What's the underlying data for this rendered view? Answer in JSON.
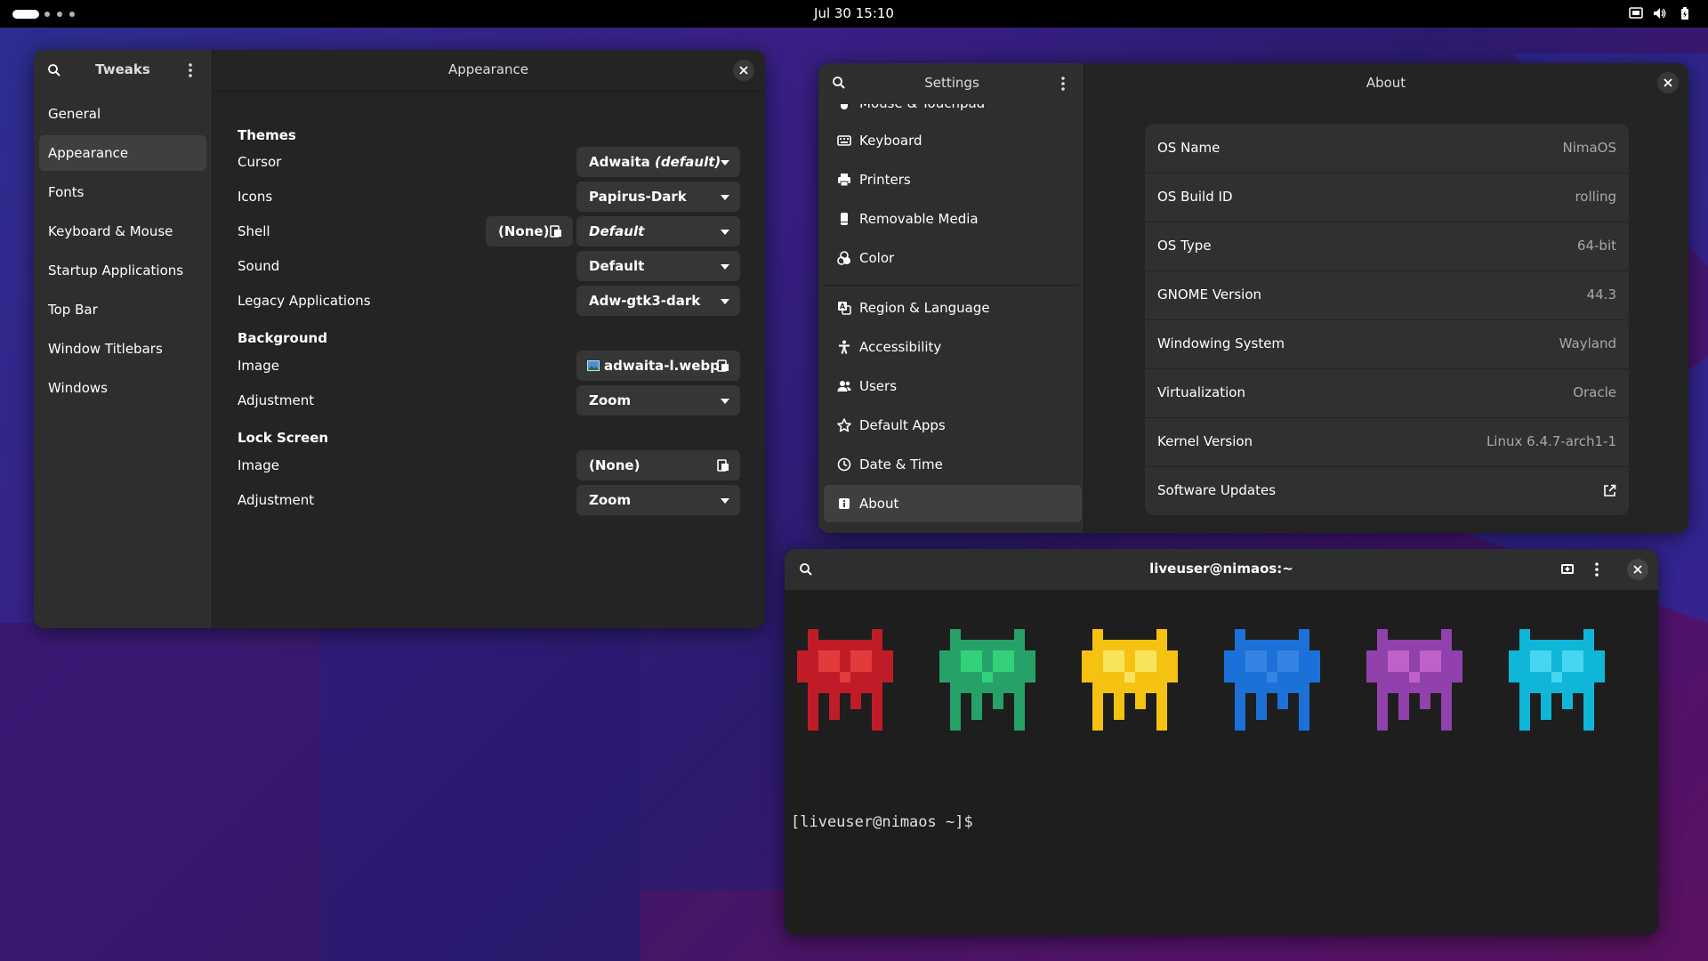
{
  "topbar": {
    "datetime": "Jul 30  15:10"
  },
  "tweaks": {
    "app_title": "Tweaks",
    "page_title": "Appearance",
    "nav": [
      "General",
      "Appearance",
      "Fonts",
      "Keyboard & Mouse",
      "Startup Applications",
      "Top Bar",
      "Window Titlebars",
      "Windows"
    ],
    "sections": {
      "themes": "Themes",
      "background": "Background",
      "lock_screen": "Lock Screen"
    },
    "labels": {
      "cursor": "Cursor",
      "icons": "Icons",
      "shell": "Shell",
      "sound": "Sound",
      "legacy": "Legacy Applications",
      "bg_image": "Image",
      "bg_adjust": "Adjustment",
      "ls_image": "Image",
      "ls_adjust": "Adjustment"
    },
    "values": {
      "cursor_name": "Adwaita",
      "cursor_suffix": "(default)",
      "icons": "Papirus-Dark",
      "shell_file": "(None)",
      "shell": "Default",
      "sound": "Default",
      "legacy": "Adw-gtk3-dark",
      "bg_image": "adwaita-l.webp",
      "bg_adjust": "Zoom",
      "ls_image": "(None)",
      "ls_adjust": "Zoom"
    }
  },
  "settings": {
    "app_title": "Settings",
    "page_title": "About",
    "nav": [
      {
        "label": "Mouse & Touchpad",
        "icon": "mouse-icon"
      },
      {
        "label": "Keyboard",
        "icon": "keyboard-icon"
      },
      {
        "label": "Printers",
        "icon": "printer-icon"
      },
      {
        "label": "Removable Media",
        "icon": "usb-icon"
      },
      {
        "label": "Color",
        "icon": "color-icon"
      },
      {
        "label": "Region & Language",
        "icon": "region-icon"
      },
      {
        "label": "Accessibility",
        "icon": "accessibility-icon"
      },
      {
        "label": "Users",
        "icon": "users-icon"
      },
      {
        "label": "Default Apps",
        "icon": "star-icon"
      },
      {
        "label": "Date & Time",
        "icon": "clock-icon"
      },
      {
        "label": "About",
        "icon": "info-icon"
      }
    ],
    "about": [
      {
        "key": "OS Name",
        "value": "NimaOS"
      },
      {
        "key": "OS Build ID",
        "value": "rolling"
      },
      {
        "key": "OS Type",
        "value": "64-bit"
      },
      {
        "key": "GNOME Version",
        "value": "44.3"
      },
      {
        "key": "Windowing System",
        "value": "Wayland"
      },
      {
        "key": "Virtualization",
        "value": "Oracle"
      },
      {
        "key": "Kernel Version",
        "value": "Linux 6.4.7-arch1-1"
      },
      {
        "key": "Software Updates",
        "value": ""
      }
    ]
  },
  "terminal": {
    "title": "liveuser@nimaos:~",
    "prompt": "[liveuser@nimaos ~]$",
    "invader_colors": [
      "#c01c28",
      "#26a269",
      "#f5c211",
      "#1c71d8",
      "#9141ac",
      "#0fb6d8"
    ],
    "invader_highlights": [
      "#e33b3b",
      "#33d17a",
      "#f8e45c",
      "#3584e4",
      "#c061cb",
      "#46d6f0"
    ]
  },
  "colors": {
    "window_bg": "#242424",
    "sidebar_bg": "#2e2e2e",
    "accent": "#3584e4"
  }
}
